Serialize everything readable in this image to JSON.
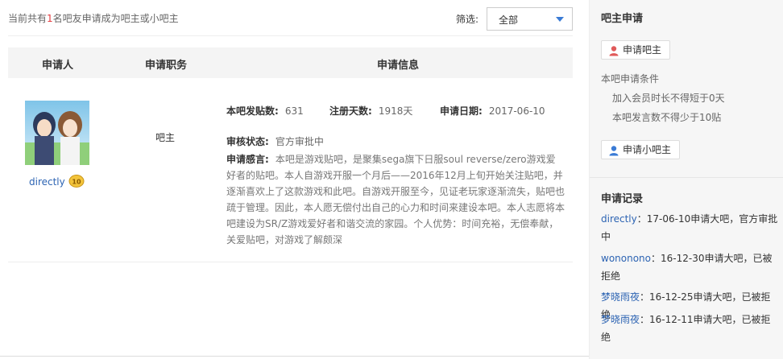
{
  "summary": {
    "prefix": "当前共有",
    "count": "1",
    "suffix": "名吧友申请成为吧主或小吧主"
  },
  "filter": {
    "label": "筛选:",
    "selected": "全部"
  },
  "table": {
    "headers": [
      "申请人",
      "申请职务",
      "申请信息"
    ]
  },
  "application": {
    "username": "directly",
    "level": "10",
    "position": "吧主",
    "posts_label": "本吧发贴数:",
    "posts": "631",
    "reg_days_label": "注册天数:",
    "reg_days": "1918天",
    "date_label": "申请日期:",
    "date": "2017-06-10",
    "status_label": "审核状态:",
    "status": "官方审批中",
    "reason_label": "申请感言:",
    "reason": "本吧是游戏贴吧，是聚集sega旗下日服soul reverse/zero游戏爱好者的贴吧。本人自游戏开服一个月后——2016年12月上旬开始关注贴吧，并逐渐喜欢上了这款游戏和此吧。自游戏开服至今，见证老玩家逐渐流失，贴吧也疏于管理。因此，本人愿无偿付出自己的心力和时间来建设本吧。本人志愿将本吧建设为SR/Z游戏爱好者和谐交流的家园。个人优势：时间充裕，无偿奉献，关爱贴吧，对游戏了解颇深"
  },
  "sidebar": {
    "apply_title": "吧主申请",
    "apply_master_btn": "申请吧主",
    "conditions_title": "本吧申请条件",
    "condition_1": "加入会员时长不得短于0天",
    "condition_2": "本吧发言数不得少于10贴",
    "apply_minor_btn": "申请小吧主",
    "records_title": "申请记录",
    "records": [
      {
        "user": "directly",
        "text": "：17-06-10申请大吧，官方审批中"
      },
      {
        "user": "wononono",
        "text": "：16-12-30申请大吧，已被拒绝"
      },
      {
        "user": "梦晓雨夜",
        "text": "：16-12-25申请大吧，已被拒绝"
      },
      {
        "user": "梦晓雨夜",
        "text": "：16-12-11申请大吧，已被拒绝"
      }
    ]
  },
  "colors": {
    "link": "#2d64b3",
    "count_highlight": "#e4393c",
    "caret": "#3a7bd5"
  }
}
